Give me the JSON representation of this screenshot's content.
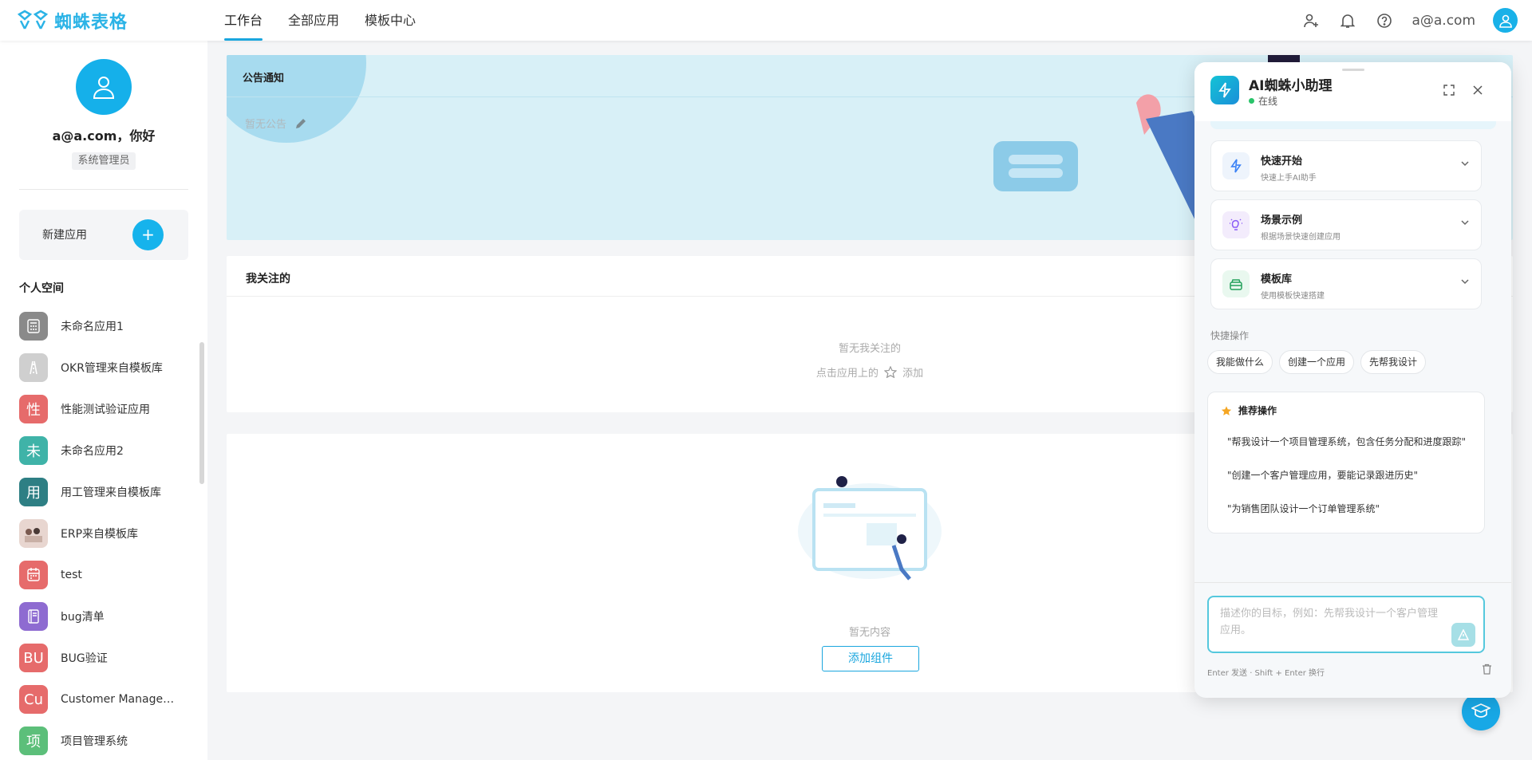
{
  "brand": {
    "name": "蜘蛛表格"
  },
  "nav": {
    "tabs": [
      {
        "label": "工作台"
      },
      {
        "label": "全部应用"
      },
      {
        "label": "模板中心"
      }
    ]
  },
  "user": {
    "email": "a@a.com"
  },
  "sidebar": {
    "greeting": "a@a.com，你好",
    "role": "系统管理员",
    "new_app_label": "新建应用",
    "new_app_plus": "+",
    "space_title": "个人空间",
    "apps": [
      {
        "name": "未命名应用1",
        "icon_text": "",
        "icon": "calculator-icon",
        "color": "#8a8a8a"
      },
      {
        "name": "OKR管理来自模板库",
        "icon_text": "",
        "icon": "road-icon",
        "color": "#cfcfcf"
      },
      {
        "name": "性能测试验证应用",
        "icon_text": "性",
        "icon": "",
        "color": "#e66b6b"
      },
      {
        "name": "未命名应用2",
        "icon_text": "未",
        "icon": "",
        "color": "#3fb3a8"
      },
      {
        "name": "用工管理来自模板库",
        "icon_text": "用",
        "icon": "",
        "color": "#2e7f84"
      },
      {
        "name": "ERP来自模板库",
        "icon_text": "",
        "icon": "people-photo-icon",
        "color": "#e8d6d0"
      },
      {
        "name": "test",
        "icon_text": "",
        "icon": "calendar-icon",
        "color": "#e66b6b"
      },
      {
        "name": "bug清单",
        "icon_text": "",
        "icon": "book-icon",
        "color": "#8e6bd1"
      },
      {
        "name": "BUG验证",
        "icon_text": "BU",
        "icon": "",
        "color": "#e66b6b"
      },
      {
        "name": "Customer Manageme...",
        "icon_text": "Cu",
        "icon": "",
        "color": "#e66b6b"
      },
      {
        "name": "项目管理系统",
        "icon_text": "项",
        "icon": "",
        "color": "#5cbf7a"
      }
    ]
  },
  "notice": {
    "title": "公告通知",
    "empty": "暂无公告"
  },
  "follow": {
    "title": "我关注的",
    "empty": "暂无我关注的",
    "hint_prefix": "点击应用上的",
    "hint_suffix": "添加"
  },
  "widgets": {
    "empty": "暂无内容",
    "add_label": "添加组件"
  },
  "ai": {
    "title": "AI蜘蛛小助理",
    "status": "在线",
    "sections": [
      {
        "title": "快速开始",
        "sub": "快速上手AI助手",
        "icon": "lightning-icon",
        "tint": "#eef4fc",
        "color": "#3b82f6"
      },
      {
        "title": "场景示例",
        "sub": "根据场景快速创建应用",
        "icon": "bulb-icon",
        "tint": "#f3ecfc",
        "color": "#8b5cf6"
      },
      {
        "title": "模板库",
        "sub": "使用模板快速搭建",
        "icon": "layers-icon",
        "tint": "#e9f8ef",
        "color": "#22a05a"
      }
    ],
    "quick_title": "快捷操作",
    "quick_actions": [
      "我能做什么",
      "创建一个应用",
      "先帮我设计"
    ],
    "recommend_title": "推荐操作",
    "recommendations": [
      "\"帮我设计一个项目管理系统，包含任务分配和进度跟踪\"",
      "\"创建一个客户管理应用，要能记录跟进历史\"",
      "\"为销售团队设计一个订单管理系统\""
    ],
    "input_placeholder": "描述你的目标，例如：先帮我设计一个客户管理应用。",
    "hint": "Enter 发送 · Shift + Enter 换行"
  },
  "colors": {
    "accent": "#1aa6de",
    "notice_bg": "#d8f0f7",
    "ai_gradient": "#14c3d6"
  }
}
